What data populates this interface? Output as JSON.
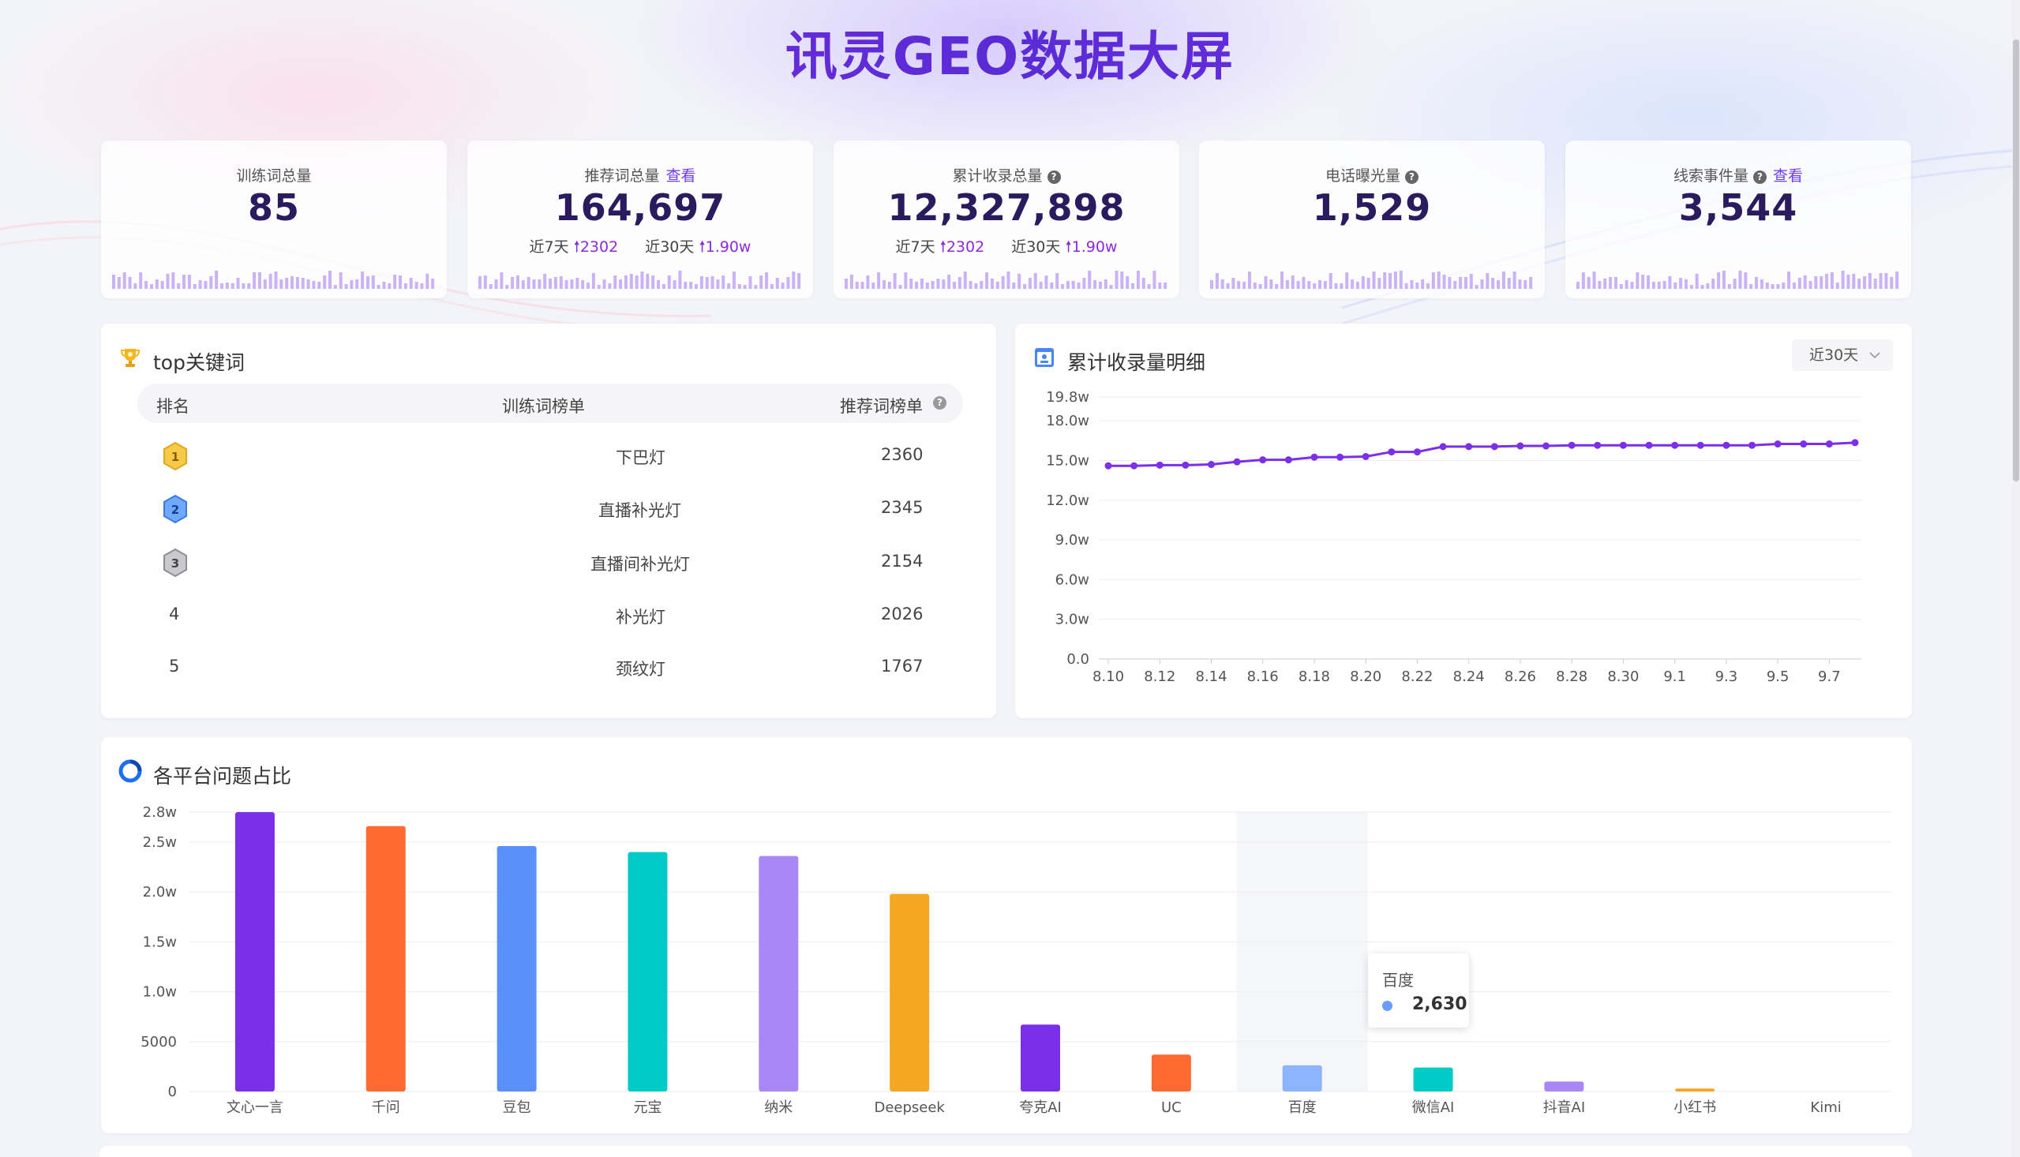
{
  "header": {
    "title": "讯灵GEO数据大屏"
  },
  "colors": {
    "accent": "#7b2fe8",
    "title_gradient_start": "#8a2be2",
    "spark_bar": "#c9b2f6"
  },
  "stats": [
    {
      "label": "训练词总量",
      "value": "85",
      "link": "",
      "help": false,
      "sub": null
    },
    {
      "label": "推荐词总量",
      "value": "164,697",
      "link": "查看",
      "help": false,
      "sub": {
        "d7_label": "近7天",
        "d7_value": "2302",
        "d30_label": "近30天",
        "d30_value": "1.90w"
      }
    },
    {
      "label": "累计收录总量",
      "value": "12,327,898",
      "link": "",
      "help": true,
      "sub": {
        "d7_label": "近7天",
        "d7_value": "2302",
        "d30_label": "近30天",
        "d30_value": "1.90w"
      }
    },
    {
      "label": "电话曝光量",
      "value": "1,529",
      "link": "",
      "help": true,
      "sub": null
    },
    {
      "label": "线索事件量",
      "value": "3,544",
      "link": "查看",
      "help": true,
      "sub": null
    }
  ],
  "top_keywords": {
    "title": "top关键词",
    "icon": "trophy-icon",
    "columns": {
      "rank": "排名",
      "train": "训练词榜单",
      "recommend": "推荐词榜单"
    },
    "rows": [
      {
        "rank": "1",
        "keyword": "下巴灯",
        "count": "2360",
        "badge": "gold"
      },
      {
        "rank": "2",
        "keyword": "直播补光灯",
        "count": "2345",
        "badge": "blue"
      },
      {
        "rank": "3",
        "keyword": "直播间补光灯",
        "count": "2154",
        "badge": "silver"
      },
      {
        "rank": "4",
        "keyword": "补光灯",
        "count": "2026",
        "badge": ""
      },
      {
        "rank": "5",
        "keyword": "颈纹灯",
        "count": "1767",
        "badge": ""
      }
    ]
  },
  "line_panel": {
    "title": "累计收录量明细",
    "icon": "calendar-icon",
    "range": "近30天"
  },
  "bar_panel": {
    "title": "各平台问题占比",
    "icon": "pie-icon"
  },
  "tooltip": {
    "name": "百度",
    "value": "2,630",
    "color": "#6a9dff"
  },
  "chart_data": [
    {
      "type": "line",
      "title": "累计收录量明细",
      "x": [
        "8.10",
        "8.11",
        "8.12",
        "8.13",
        "8.14",
        "8.15",
        "8.16",
        "8.17",
        "8.18",
        "8.19",
        "8.20",
        "8.21",
        "8.22",
        "8.23",
        "8.24",
        "8.25",
        "8.26",
        "8.27",
        "8.28",
        "8.29",
        "8.30",
        "8.31",
        "9.1",
        "9.2",
        "9.3",
        "9.4",
        "9.5",
        "9.6",
        "9.7",
        "9.8"
      ],
      "x_tick_labels": [
        "8.10",
        "8.12",
        "8.14",
        "8.16",
        "8.18",
        "8.20",
        "8.22",
        "8.24",
        "8.26",
        "8.28",
        "8.30",
        "9.1",
        "9.3",
        "9.5",
        "9.7"
      ],
      "series": [
        {
          "values": [
            146000,
            146000,
            146500,
            146500,
            147000,
            149000,
            150500,
            150500,
            152500,
            152500,
            153000,
            156500,
            156500,
            160500,
            160500,
            160500,
            161000,
            161000,
            161500,
            161500,
            161500,
            161500,
            161500,
            161500,
            161500,
            161500,
            162500,
            162500,
            162500,
            163500
          ]
        }
      ],
      "y_ticks": [
        "0.0",
        "3.0w",
        "6.0w",
        "9.0w",
        "12.0w",
        "15.0w",
        "18.0w",
        "19.8w"
      ],
      "ylim": [
        0,
        198000
      ],
      "color": "#7b2fe8",
      "grid": true
    },
    {
      "type": "bar",
      "title": "各平台问题占比",
      "categories": [
        "文心一言",
        "千问",
        "豆包",
        "元宝",
        "纳米",
        "Deepseek",
        "夸克AI",
        "UC",
        "百度",
        "微信AI",
        "抖音AI",
        "小红书",
        "Kimi"
      ],
      "values": [
        28000,
        26600,
        24600,
        24000,
        23600,
        19800,
        6700,
        3700,
        2630,
        2400,
        1000,
        300,
        0
      ],
      "colors": [
        "#7b2fe8",
        "#ff6a33",
        "#5b8ff9",
        "#00cbc7",
        "#a987f7",
        "#f5a623",
        "#7b2fe8",
        "#ff6a33",
        "#7aa8ff",
        "#00cbc7",
        "#a987f7",
        "#f5a623",
        "#5b8ff9"
      ],
      "y_ticks": [
        "0",
        "5000",
        "1.0w",
        "1.5w",
        "2.0w",
        "2.5w",
        "2.8w"
      ],
      "ylim": [
        0,
        28000
      ],
      "highlight_category": "百度",
      "grid": true
    }
  ]
}
